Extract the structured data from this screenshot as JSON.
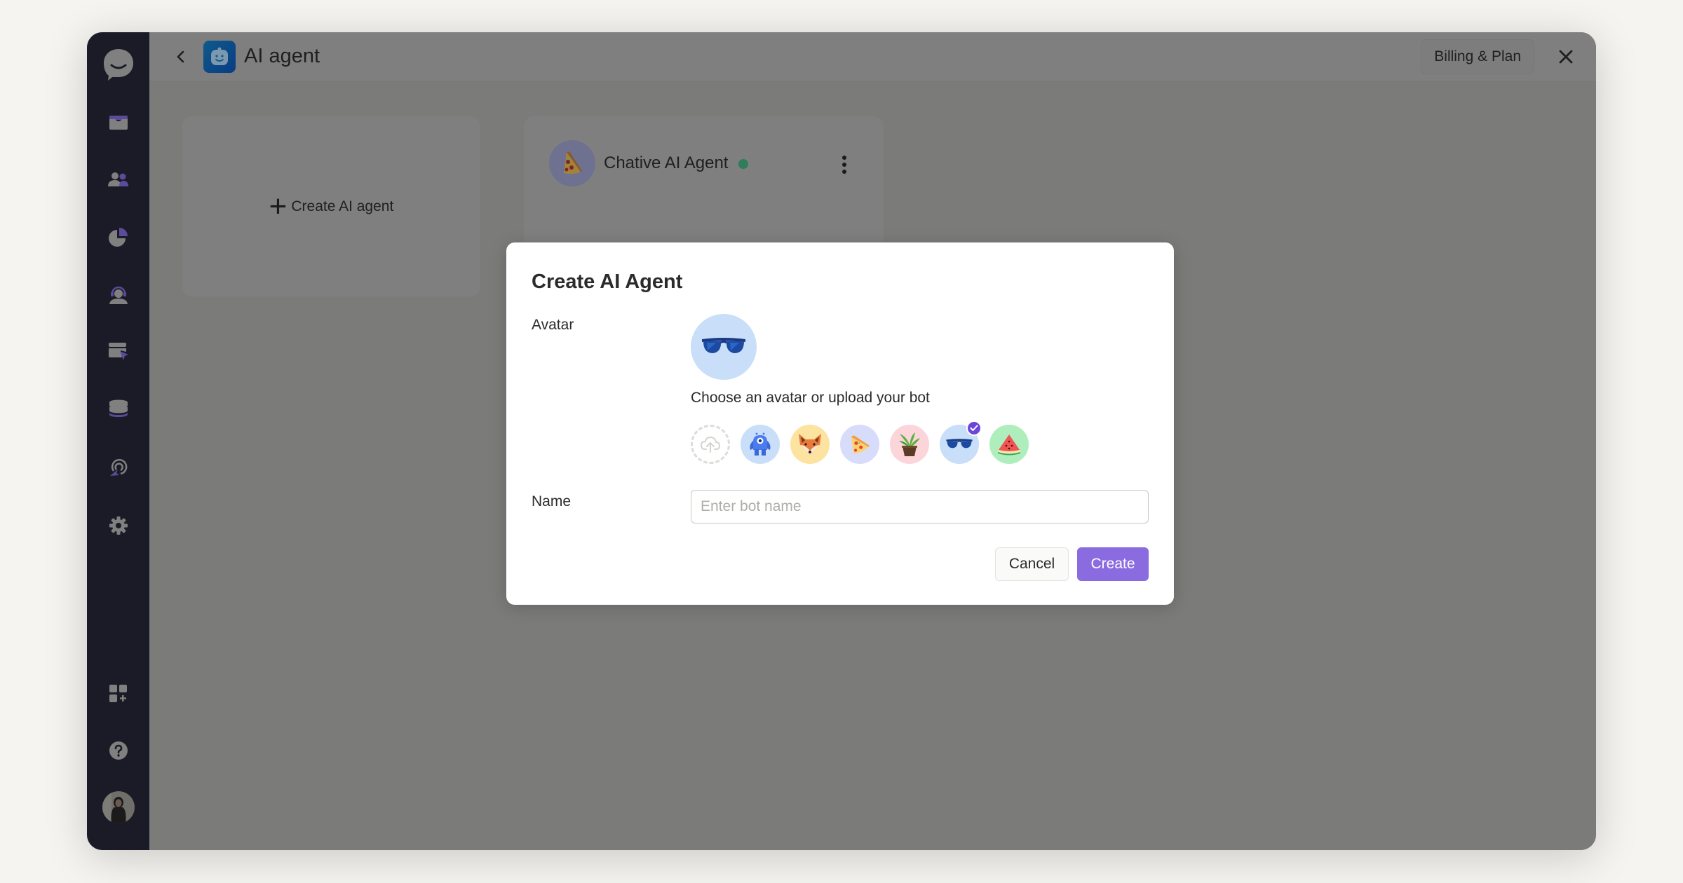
{
  "header": {
    "title": "AI agent",
    "billing_label": "Billing & Plan",
    "back_icon": "chevron-left-icon",
    "close_icon": "close-icon"
  },
  "sidebar": {
    "logo": "chat-bubble-logo",
    "items": [
      {
        "name": "inbox",
        "icon": "inbox-icon"
      },
      {
        "name": "contacts",
        "icon": "users-icon"
      },
      {
        "name": "reports",
        "icon": "pie-chart-icon"
      },
      {
        "name": "agents",
        "icon": "headset-agent-icon"
      },
      {
        "name": "widget",
        "icon": "window-cursor-icon"
      },
      {
        "name": "knowledge",
        "icon": "database-icon"
      },
      {
        "name": "tracking",
        "icon": "signal-cursor-icon"
      },
      {
        "name": "settings",
        "icon": "gear-icon"
      }
    ],
    "bottom_items": [
      {
        "name": "apps",
        "icon": "apps-add-icon"
      },
      {
        "name": "help",
        "icon": "help-icon"
      },
      {
        "name": "profile",
        "icon": "user-avatar"
      }
    ]
  },
  "cards": {
    "create_label": "Create AI agent",
    "agents": [
      {
        "name": "Chative AI Agent",
        "avatar": "pizza",
        "status": "online",
        "status_color": "#2f9e6a"
      }
    ]
  },
  "modal": {
    "title": "Create AI Agent",
    "avatar_label": "Avatar",
    "selected_avatar": "sunglasses",
    "help_text": "Choose an avatar or upload your bot",
    "avatars": [
      {
        "id": "upload",
        "icon": "upload-cloud-icon"
      },
      {
        "id": "monster",
        "bg": "#c9def8"
      },
      {
        "id": "fox",
        "bg": "#fde3a0"
      },
      {
        "id": "pizza",
        "bg": "#d8dcfb"
      },
      {
        "id": "plant",
        "bg": "#fbd5da"
      },
      {
        "id": "sunglasses",
        "bg": "#c9def8",
        "selected": true
      },
      {
        "id": "watermelon",
        "bg": "#aeeebd"
      }
    ],
    "name_label": "Name",
    "name_value": "",
    "name_placeholder": "Enter bot name",
    "cancel_label": "Cancel",
    "create_label": "Create",
    "accent_color": "#8b6be0"
  }
}
